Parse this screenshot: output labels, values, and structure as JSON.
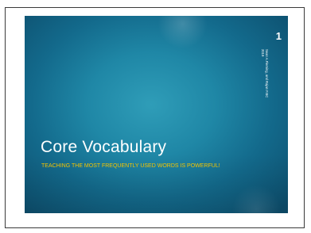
{
  "slide": {
    "number": "1",
    "side_line_1": "Sean A.Fleming, and Rajan F.BC",
    "side_line_2": "2019",
    "title": "Core Vocabulary",
    "subtitle": "TEACHING THE MOST FREQUENTLY USED WORDS IS POWERFUL!"
  },
  "colors": {
    "slide_bg_center": "#2f9db8",
    "slide_bg_edge": "#0d4f6e",
    "title_color": "#ffffff",
    "subtitle_color": "#f5c400"
  }
}
